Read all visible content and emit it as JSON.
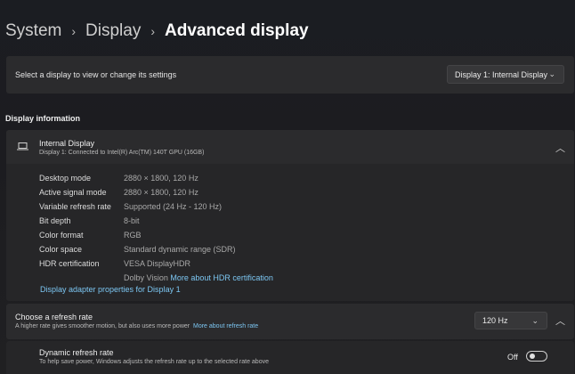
{
  "breadcrumb": {
    "items": [
      "System",
      "Display"
    ],
    "current": "Advanced display"
  },
  "display_selector": {
    "label": "Select a display to view or change its settings",
    "selected": "Display 1: Internal Display"
  },
  "display_info": {
    "section_title": "Display information",
    "name": "Internal Display",
    "subtitle": "Display 1: Connected to Intel(R) Arc(TM) 140T GPU (16GB)",
    "rows": [
      {
        "label": "Desktop mode",
        "value": "2880 × 1800, 120 Hz"
      },
      {
        "label": "Active signal mode",
        "value": "2880 × 1800, 120 Hz"
      },
      {
        "label": "Variable refresh rate",
        "value": "Supported (24 Hz - 120 Hz)"
      },
      {
        "label": "Bit depth",
        "value": "8-bit"
      },
      {
        "label": "Color format",
        "value": "RGB"
      },
      {
        "label": "Color space",
        "value": "Standard dynamic range (SDR)"
      },
      {
        "label": "HDR certification",
        "value": "VESA DisplayHDR"
      }
    ],
    "hdr_extra": "Dolby Vision",
    "hdr_link": "More about HDR certification",
    "adapter_link": "Display adapter properties for Display 1"
  },
  "refresh_rate": {
    "title": "Choose a refresh rate",
    "description": "A higher rate gives smoother motion, but also uses more power",
    "link": "More about refresh rate",
    "selected": "120 Hz"
  },
  "dynamic_refresh": {
    "title": "Dynamic refresh rate",
    "description": "To help save power, Windows adjusts the refresh rate up to the selected rate above",
    "state_label": "Off",
    "state": false
  },
  "colors": {
    "accent_link": "#7cc6f2",
    "card_bg": "#2b2b2d",
    "page_bg": "#1c1c20"
  },
  "icons": {
    "chevron_right": "chevron-right-icon",
    "chevron_down": "chevron-down-icon",
    "chevron_up": "chevron-up-icon",
    "monitor": "laptop-icon"
  }
}
